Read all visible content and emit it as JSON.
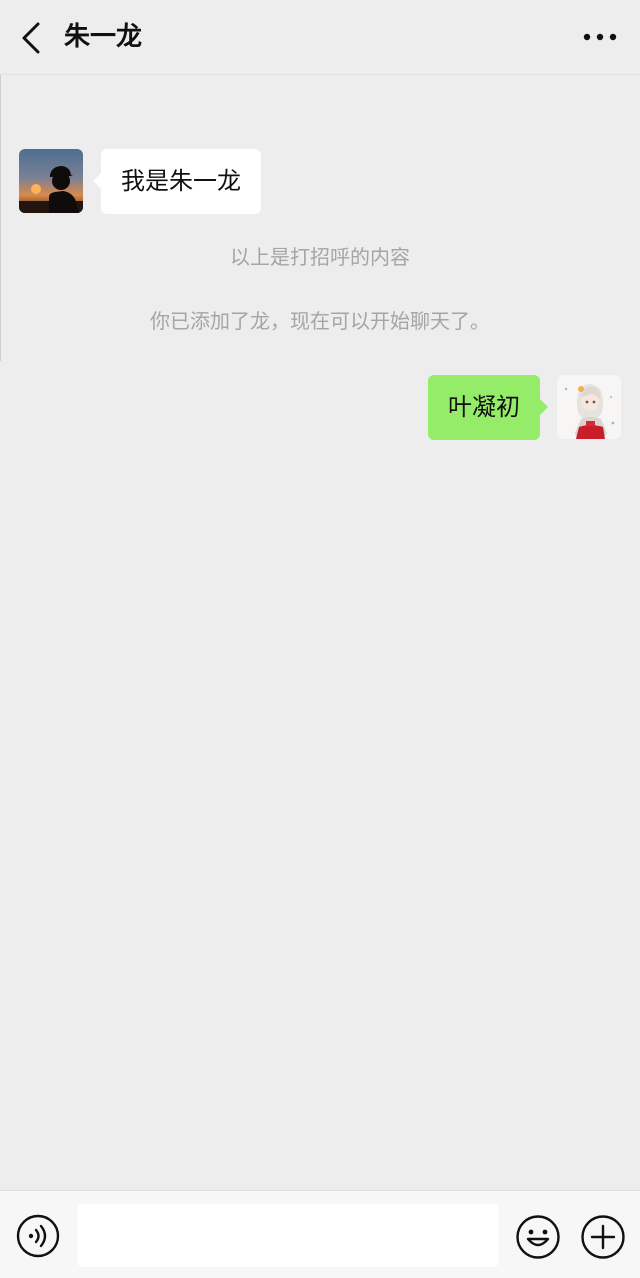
{
  "header": {
    "title": "朱一龙",
    "back_icon": "chevron-left-icon",
    "more_icon": "more-dots-icon"
  },
  "messages": [
    {
      "side": "left",
      "text": "我是朱一龙",
      "avatar": "sunset-silhouette-avatar"
    },
    {
      "side": "right",
      "text": "叶凝初",
      "avatar": "anime-girl-avatar"
    }
  ],
  "system_messages": [
    "以上是打招呼的内容",
    "你已添加了龙，现在可以开始聊天了。"
  ],
  "input": {
    "value": "",
    "placeholder": ""
  },
  "icons": {
    "voice": "voice-icon",
    "emoji": "emoji-icon",
    "plus": "plus-icon"
  },
  "colors": {
    "background": "#ededed",
    "bubble_self": "#95ec69",
    "bubble_other": "#ffffff",
    "system_text": "#a5a5a5"
  }
}
